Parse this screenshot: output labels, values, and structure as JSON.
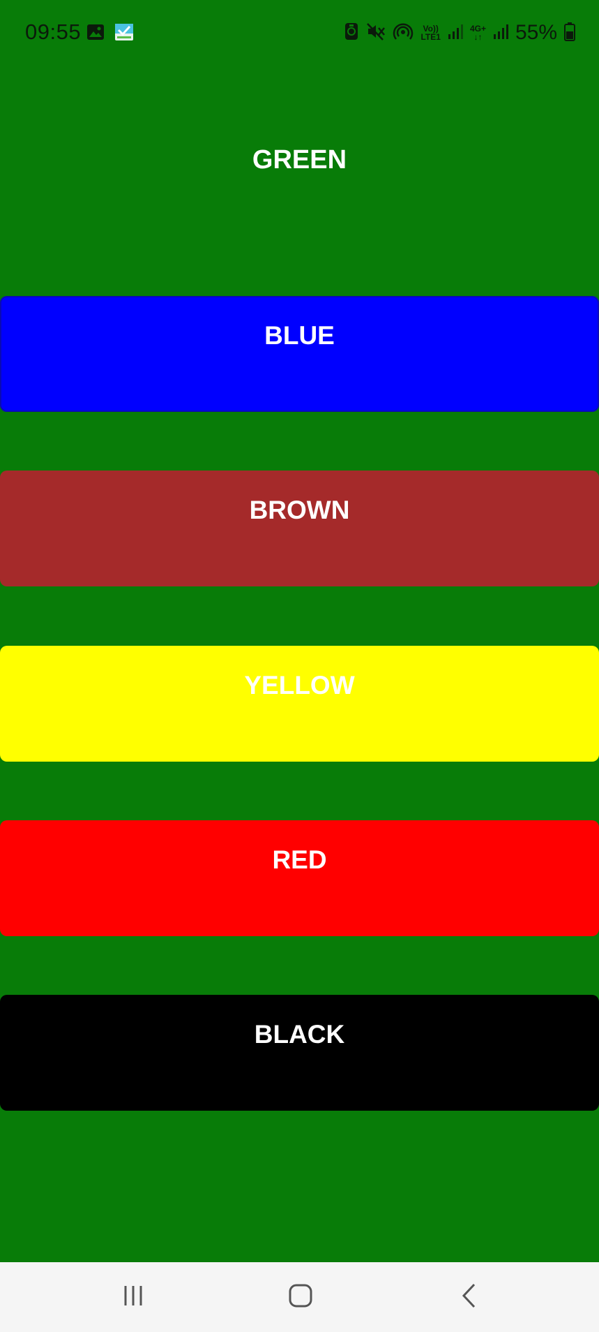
{
  "colors": {
    "background": "#087c08",
    "blue": "#0000ff",
    "brown": "#a52a2a",
    "yellow": "#ffff00",
    "red": "#ff0000",
    "black": "#000000",
    "label": "#ffffff",
    "nav_bar": "#f5f5f5"
  },
  "status_bar": {
    "time": "09:55",
    "left_icons": [
      "gallery-icon",
      "app-notification-icon"
    ],
    "right_icons": [
      "nfc-icon",
      "mute-icon",
      "hotspot-icon",
      "volte-lte1-icon",
      "signal-icon",
      "4g-icon",
      "signal-icon",
      "battery-icon"
    ],
    "volte_label": "Vo))",
    "lte_label": "LTE1",
    "network_label": "4G+",
    "battery_percent": "55%"
  },
  "main": {
    "title": "GREEN",
    "buttons": [
      {
        "label": "BLUE",
        "color": "#0000ff"
      },
      {
        "label": "BROWN",
        "color": "#a52a2a"
      },
      {
        "label": "YELLOW",
        "color": "#ffff00"
      },
      {
        "label": "RED",
        "color": "#ff0000"
      },
      {
        "label": "BLACK",
        "color": "#000000"
      }
    ]
  },
  "nav_bar": {
    "items": [
      "recents-icon",
      "home-icon",
      "back-icon"
    ]
  }
}
